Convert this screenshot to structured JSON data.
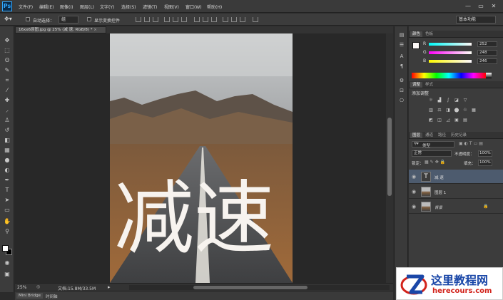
{
  "app": {
    "logo": "Ps"
  },
  "menubar": {
    "items": [
      "文件(F)",
      "编辑(E)",
      "图像(I)",
      "图层(L)",
      "文字(Y)",
      "选择(S)",
      "滤镜(T)",
      "视图(V)",
      "窗口(W)",
      "帮助(H)"
    ],
    "window_controls": [
      "—",
      "▭",
      "✕"
    ]
  },
  "options": {
    "auto_select_label": "自动选择：",
    "auto_select_value": "组",
    "show_transform_label": "显示变换控件",
    "workspace": "基本功能"
  },
  "document": {
    "tab_title": "16xx6原图.jpg @ 25% (减 速, RGB/8) *",
    "canvas_text": "减速",
    "zoom": "25%",
    "file_info": "文档:15.8M/33.5M"
  },
  "bottom_tabs": [
    "Mini Bridge",
    "时间轴"
  ],
  "tools": [
    "move-icon",
    "marquee-icon",
    "lasso-icon",
    "quick-select-icon",
    "crop-icon",
    "eyedropper-icon",
    "healing-icon",
    "brush-icon",
    "stamp-icon",
    "history-brush-icon",
    "eraser-icon",
    "gradient-icon",
    "blur-icon",
    "dodge-icon",
    "pen-icon",
    "type-icon",
    "path-select-icon",
    "shape-icon",
    "hand-icon",
    "zoom-icon"
  ],
  "panels": {
    "color": {
      "tabs": [
        "颜色",
        "色板"
      ],
      "r": {
        "label": "R",
        "value": "252"
      },
      "g": {
        "label": "G",
        "value": "248"
      },
      "b": {
        "label": "B",
        "value": "246"
      }
    },
    "adjustments": {
      "tabs": [
        "调整",
        "样式"
      ],
      "title": "添加调整"
    },
    "layers": {
      "tabs": [
        "图层",
        "通道",
        "路径",
        "历史记录"
      ],
      "filter_kind": "类型",
      "blend_mode": "正常",
      "opacity_label": "不透明度：",
      "opacity_value": "100%",
      "lock_label": "锁定：",
      "fill_label": "填充：",
      "fill_value": "100%",
      "items": [
        {
          "name": "减 速",
          "kind": "text"
        },
        {
          "name": "图层 1",
          "kind": "image"
        },
        {
          "name": "背景",
          "kind": "background"
        }
      ]
    }
  },
  "watermark": {
    "title": "这里教程网",
    "url": "herecours.com"
  },
  "colors": {
    "accent": "#31a8ff",
    "panel_bg": "#3c3c3c",
    "selected_layer": "#4d5b6e"
  }
}
